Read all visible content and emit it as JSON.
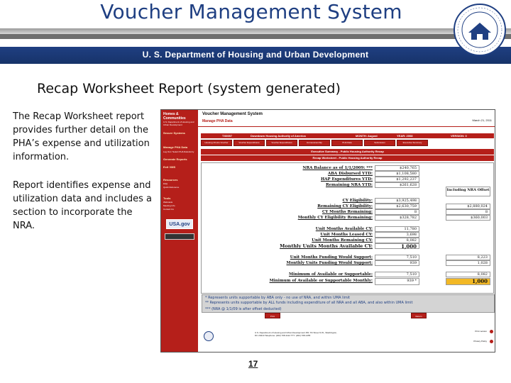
{
  "header": {
    "title": "Voucher Management System",
    "department": "U. S. Department of Housing and Urban Development",
    "seal_text": "DEPARTMENT OF HOUSING AND URBAN DEVELOPMENT"
  },
  "slide": {
    "subtitle": "Recap Worksheet Report (system generated)",
    "para1": "The Recap Worksheet report provides further detail on the PHA’s expense and utilization information.",
    "para2": "Report identifies expense and utilization data and includes a section to incorporate the NRA.",
    "page_number": "17"
  },
  "screenshot": {
    "nav": {
      "brand": "Homes & Communities",
      "brand_sub": "U.S. Department of Housing and Urban Development",
      "items": [
        "Secure Systems",
        "Manage PHA Data",
        "Generate Reports",
        "Exit VMS",
        "Resources",
        "Tools"
      ],
      "sub_items": [
        "Log Out / Select PHA Data Entry",
        "FAQ",
        "Quick Reference",
        "Webcasts",
        "Meeting Info",
        "Contact Us"
      ],
      "logo_text": "USA.gov"
    },
    "app": {
      "title": "Voucher Management System",
      "section": "Manage PHA Data",
      "date": "March 21, 2011"
    },
    "info": {
      "pha_code": "TX0097",
      "pha_name": "Downtown Housing Authority of America",
      "month": "MONTH: August",
      "year": "YEAR: 2008",
      "version": "VERSION: 0"
    },
    "tabs": [
      "Housing Choice Voucher",
      "Voucher Expenditures",
      "Voucher Expenditures",
      "Homeownership",
      "PHA Data",
      "Submission",
      "Executive Summary"
    ],
    "exec_title": "Executive Summary - Public Housing Authority Recap",
    "worksheet_title": "Recap Worksheet - Public Housing Authority Recap",
    "incl_header": "Including NRA Offset",
    "rows": [
      {
        "label": "NRA Balance as of 1/1/2009: ***",
        "value": "$240,765",
        "right": ""
      },
      {
        "label": "ABA Disbursed YTD:",
        "value": "$1,108,580",
        "right": ""
      },
      {
        "label": "HAP Expenditures YTD:",
        "value": "$1,292,237",
        "right": ""
      },
      {
        "label": "Remaining NRA YTD:",
        "value": "$261,628",
        "right": ""
      },
      {
        "label": "CY Eligibility:",
        "value": "$3,925,498",
        "right": ""
      },
      {
        "label": "Remaining CY Eligibility:",
        "value": "$2,630,759",
        "right": "$2,880,024"
      },
      {
        "label": "CY Months Remaining:",
        "value": "8",
        "right": "8"
      },
      {
        "label": "Monthly CY Eligibility Remaining:",
        "value": "$328,782",
        "right": "$360,003"
      },
      {
        "label": "Unit Months Available CY:",
        "value": "11,780",
        "right": ""
      },
      {
        "label": "Unit Months Leased CY:",
        "value": "3,698",
        "right": ""
      },
      {
        "label": "Unit Months Remaining CY:",
        "value": "8,082",
        "right": ""
      },
      {
        "label": "Monthly Units Months Available CY:",
        "value": "1,000",
        "right": ""
      },
      {
        "label": "Unit Months Funding Would Support:",
        "value": "7,510",
        "right": "8,223"
      },
      {
        "label": "Monthly Units Funding Would Support:",
        "value": "939",
        "right": "1,028"
      },
      {
        "label": "Minimum of Available or Supportable:",
        "value": "7,510",
        "right": "8,082"
      },
      {
        "label": "Minimum of Available or Supportable Monthly:",
        "value": "939 *",
        "right": "1,000"
      }
    ],
    "notes": [
      "* Represents units supportable by ABA only - no use of NRA, and within UMA limit",
      "** Represents units supportable by ALL funds including expenditure of all NRA and all ABA, and also within UMA limit",
      "*** (NRA @ 1/1/09 is after offset deducted)"
    ],
    "buttons": [
      "Print",
      "Return"
    ],
    "footer_text": "U.S. Department of Housing and Urban Development 451 7th Street S.W., Washington, DC 20410 Telephone: (202) 708-1112 TTY: (202) 708-1455",
    "footer_links": [
      "Print version",
      "Privacy Policy"
    ]
  },
  "colors": {
    "hud_blue": "#1f3f82",
    "nav_red": "#b51f1a",
    "highlight": "#f2b825"
  }
}
